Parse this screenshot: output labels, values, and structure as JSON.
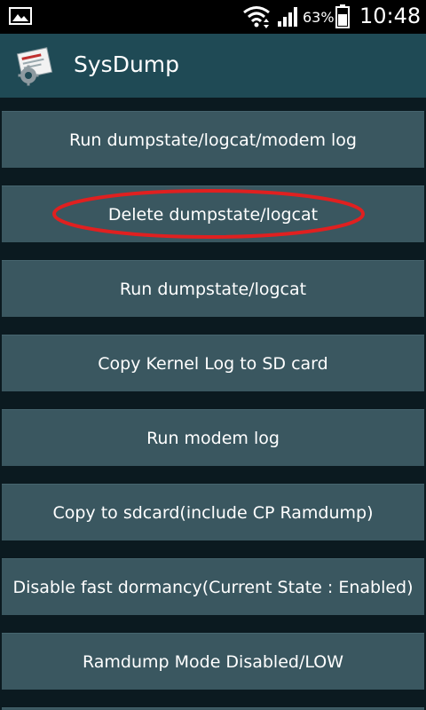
{
  "status_bar": {
    "battery": "63%",
    "time": "10:48"
  },
  "app_bar": {
    "title": "SysDump"
  },
  "buttons": [
    {
      "label": "Run dumpstate/logcat/modem log"
    },
    {
      "label": "Delete dumpstate/logcat"
    },
    {
      "label": "Run dumpstate/logcat"
    },
    {
      "label": "Copy Kernel Log to SD card"
    },
    {
      "label": "Run modem log"
    },
    {
      "label": "Copy to sdcard(include CP Ramdump)"
    },
    {
      "label": "Disable fast dormancy(Current State : Enabled)"
    },
    {
      "label": "Ramdump Mode Disabled/LOW"
    }
  ],
  "colors": {
    "status_bar": "#000000",
    "app_bar": "#1f4a55",
    "background": "#0b1a20",
    "button": "#3a5760",
    "annotation": "#e02020"
  }
}
